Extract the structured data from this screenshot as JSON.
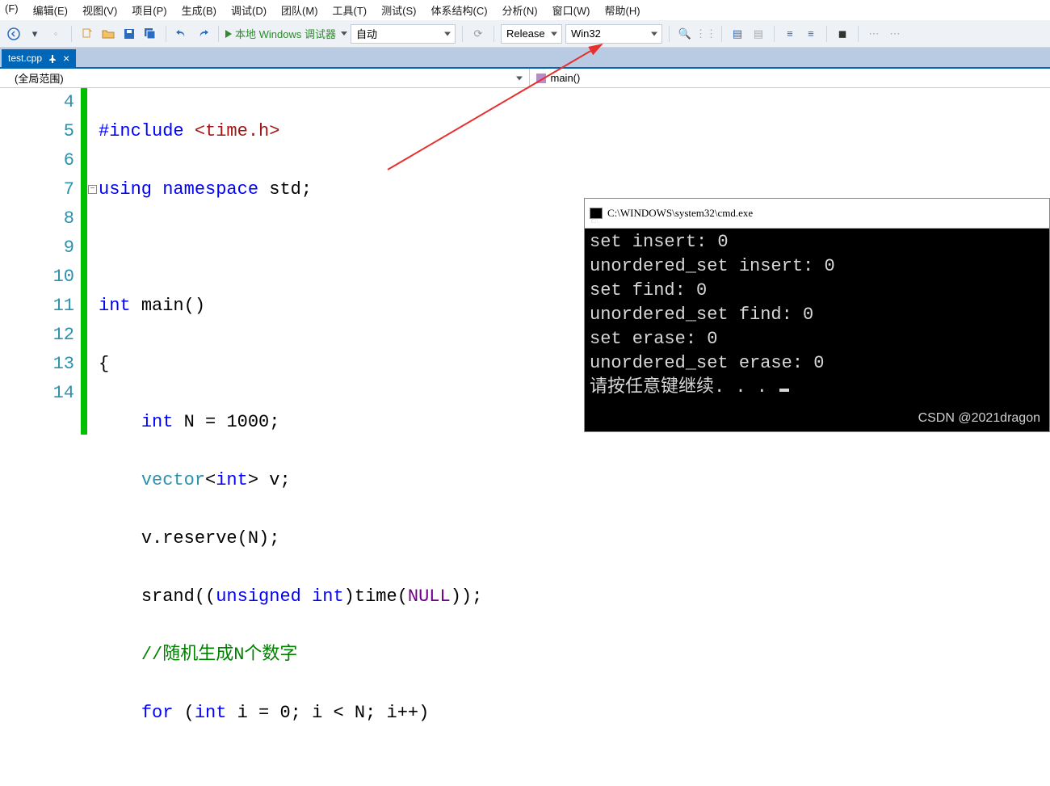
{
  "menu": {
    "items": [
      "(F)",
      "编辑(E)",
      "视图(V)",
      "项目(P)",
      "生成(B)",
      "调试(D)",
      "团队(M)",
      "工具(T)",
      "测试(S)",
      "体系结构(C)",
      "分析(N)",
      "窗口(W)",
      "帮助(H)"
    ]
  },
  "toolbar": {
    "debug_label": "本地 Windows 调试器",
    "auto_label": "自动",
    "config_label": "Release",
    "platform_label": "Win32"
  },
  "tab": {
    "filename": "test.cpp"
  },
  "scope": {
    "left_label": "(全局范围)",
    "right_label": "main()"
  },
  "code": {
    "lines": [
      {
        "n": "4",
        "t": "include"
      },
      {
        "n": "5",
        "t": "using"
      },
      {
        "n": "6",
        "t": "blank"
      },
      {
        "n": "7",
        "t": "main"
      },
      {
        "n": "8",
        "t": "brace"
      },
      {
        "n": "9",
        "t": "n1000"
      },
      {
        "n": "10",
        "t": "vector"
      },
      {
        "n": "11",
        "t": "reserve"
      },
      {
        "n": "12",
        "t": "srand"
      },
      {
        "n": "13",
        "t": "comment"
      },
      {
        "n": "14",
        "t": "for"
      }
    ],
    "text": {
      "include_kw": "#include",
      "include_hdr": "<time.h>",
      "using": "using",
      "namespace": "namespace",
      "std": "std",
      "int": "int",
      "main": "main",
      "N": "N",
      "eq": "=",
      "thousand": "1000",
      "vector": "vector",
      "v": "v",
      "reserve": "reserve",
      "srand": "srand",
      "unsigned": "unsigned",
      "time": "time",
      "NULL": "NULL",
      "comment": "//随机生成N个数字",
      "for": "for",
      "i": "i",
      "zero": "0",
      "lt": "<",
      "pp": "++"
    }
  },
  "console": {
    "title": "C:\\WINDOWS\\system32\\cmd.exe",
    "lines": [
      "set insert: 0",
      "unordered_set insert: 0",
      "set find: 0",
      "unordered_set find: 0",
      "set erase: 0",
      "unordered_set erase: 0",
      "请按任意键继续. . ."
    ]
  },
  "watermark": "CSDN @2021dragon"
}
